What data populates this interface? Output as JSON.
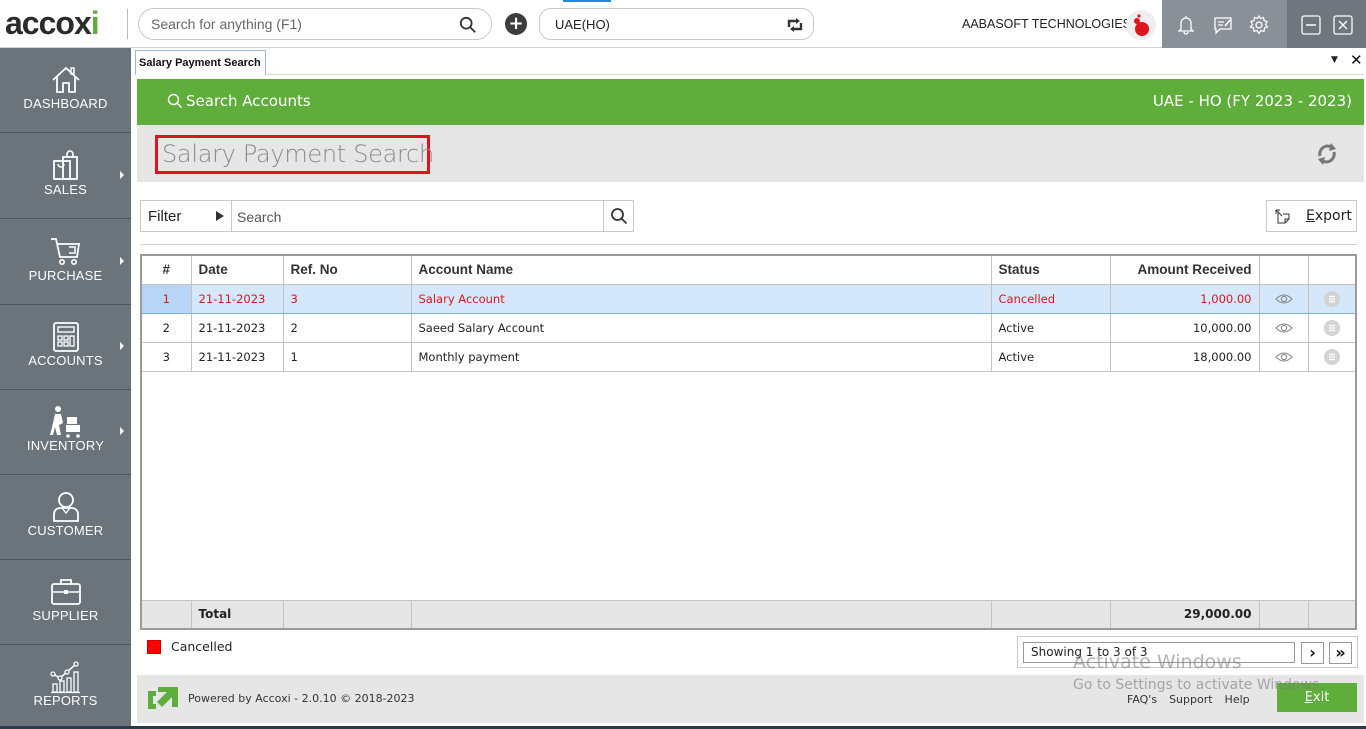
{
  "app": {
    "logo_text_main": "accox",
    "logo_text_i": "i",
    "global_search_placeholder": "Search for anything (F1)",
    "branch": "UAE(HO)",
    "company": "AABASOFT TECHNOLOGIES"
  },
  "sidebar": {
    "items": [
      {
        "label": "DASHBOARD",
        "icon": "home-icon",
        "has_submenu": false
      },
      {
        "label": "SALES",
        "icon": "shopping-bag-icon",
        "has_submenu": true
      },
      {
        "label": "PURCHASE",
        "icon": "cart-icon",
        "has_submenu": true
      },
      {
        "label": "ACCOUNTS",
        "icon": "calculator-icon",
        "has_submenu": true
      },
      {
        "label": "INVENTORY",
        "icon": "inventory-icon",
        "has_submenu": true
      },
      {
        "label": "CUSTOMER",
        "icon": "user-icon",
        "has_submenu": false
      },
      {
        "label": "SUPPLIER",
        "icon": "briefcase-icon",
        "has_submenu": false
      },
      {
        "label": "REPORTS",
        "icon": "chart-icon",
        "has_submenu": false
      }
    ]
  },
  "tab": {
    "label": "Salary Payment Search"
  },
  "header": {
    "section": "Search Accounts",
    "org": "UAE - HO (FY 2023 - 2023)",
    "page_title": "Salary Payment Search"
  },
  "toolbar": {
    "filter_label": "Filter",
    "search_placeholder": "Search",
    "export_label_first": "E",
    "export_label_rest": "xport"
  },
  "table": {
    "columns": [
      "#",
      "Date",
      "Ref. No",
      "Account Name",
      "Status",
      "Amount Received",
      "",
      ""
    ],
    "rows": [
      {
        "num": "1",
        "date": "21-11-2023",
        "ref": "3",
        "account": "Salary Account",
        "status": "Cancelled",
        "amount": "1,000.00"
      },
      {
        "num": "2",
        "date": "21-11-2023",
        "ref": "2",
        "account": "Saeed Salary Account",
        "status": "Active",
        "amount": "10,000.00"
      },
      {
        "num": "3",
        "date": "21-11-2023",
        "ref": "1",
        "account": "Monthly payment",
        "status": "Active",
        "amount": "18,000.00"
      }
    ],
    "total_label": "Total",
    "total_amount": "29,000.00"
  },
  "legend": {
    "cancelled_label": "Cancelled",
    "cancelled_color": "#ff0000"
  },
  "pager": {
    "status": "Showing 1 to 3 of 3",
    "next": "›",
    "last": "»"
  },
  "footer": {
    "powered": "Powered by Accoxi - 2.0.10 © 2018-2023",
    "links": [
      "FAQ's",
      "Support",
      "Help"
    ],
    "exit_first": "E",
    "exit_rest": "xit"
  },
  "watermark": {
    "line1": "Activate Windows",
    "line2": "Go to Settings to activate Windows."
  },
  "colors": {
    "brand_green": "#5fad3a",
    "sidebar": "#6b737b",
    "highlight_red": "#e0141c",
    "selected_row": "#d4e7fb"
  }
}
